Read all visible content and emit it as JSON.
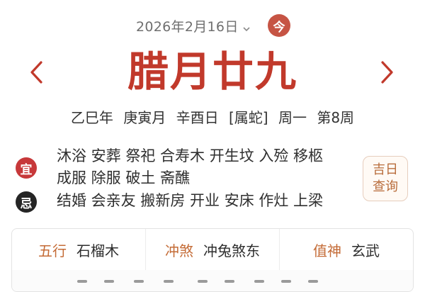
{
  "header": {
    "date": "2026年2月16日",
    "today_label": "今"
  },
  "lunar": {
    "title": "腊月廿九"
  },
  "ganzhi": {
    "year": "乙巳年",
    "month": "庚寅月",
    "day": "辛酉日",
    "zodiac": "[属蛇]",
    "weekday": "周一",
    "week": "第8周"
  },
  "yi": {
    "badge": "宜",
    "line1": "沐浴 安葬 祭祀 合寿木 开生坟 入殓 移柩",
    "line2": "成服 除服 破土 斋醮"
  },
  "ji": {
    "badge": "忌",
    "line1": "结婚 会亲友 搬新房 开业 安床 作灶 上梁"
  },
  "jiri_button": {
    "line1": "吉日",
    "line2": "查询"
  },
  "info": {
    "wuxing_label": "五行",
    "wuxing_value": "石榴木",
    "chongsha_label": "冲煞",
    "chongsha_value": "冲兔煞东",
    "zhishen_label": "值神",
    "zhishen_value": "玄武"
  },
  "colors": {
    "accent_red": "#c1392b",
    "badge_yi": "#c7383a",
    "badge_ji": "#252525",
    "label_orange": "#c46b36"
  },
  "icons": {
    "date_dropdown": "chevron-down-icon",
    "prev": "chevron-left-icon",
    "next": "chevron-right-icon"
  }
}
